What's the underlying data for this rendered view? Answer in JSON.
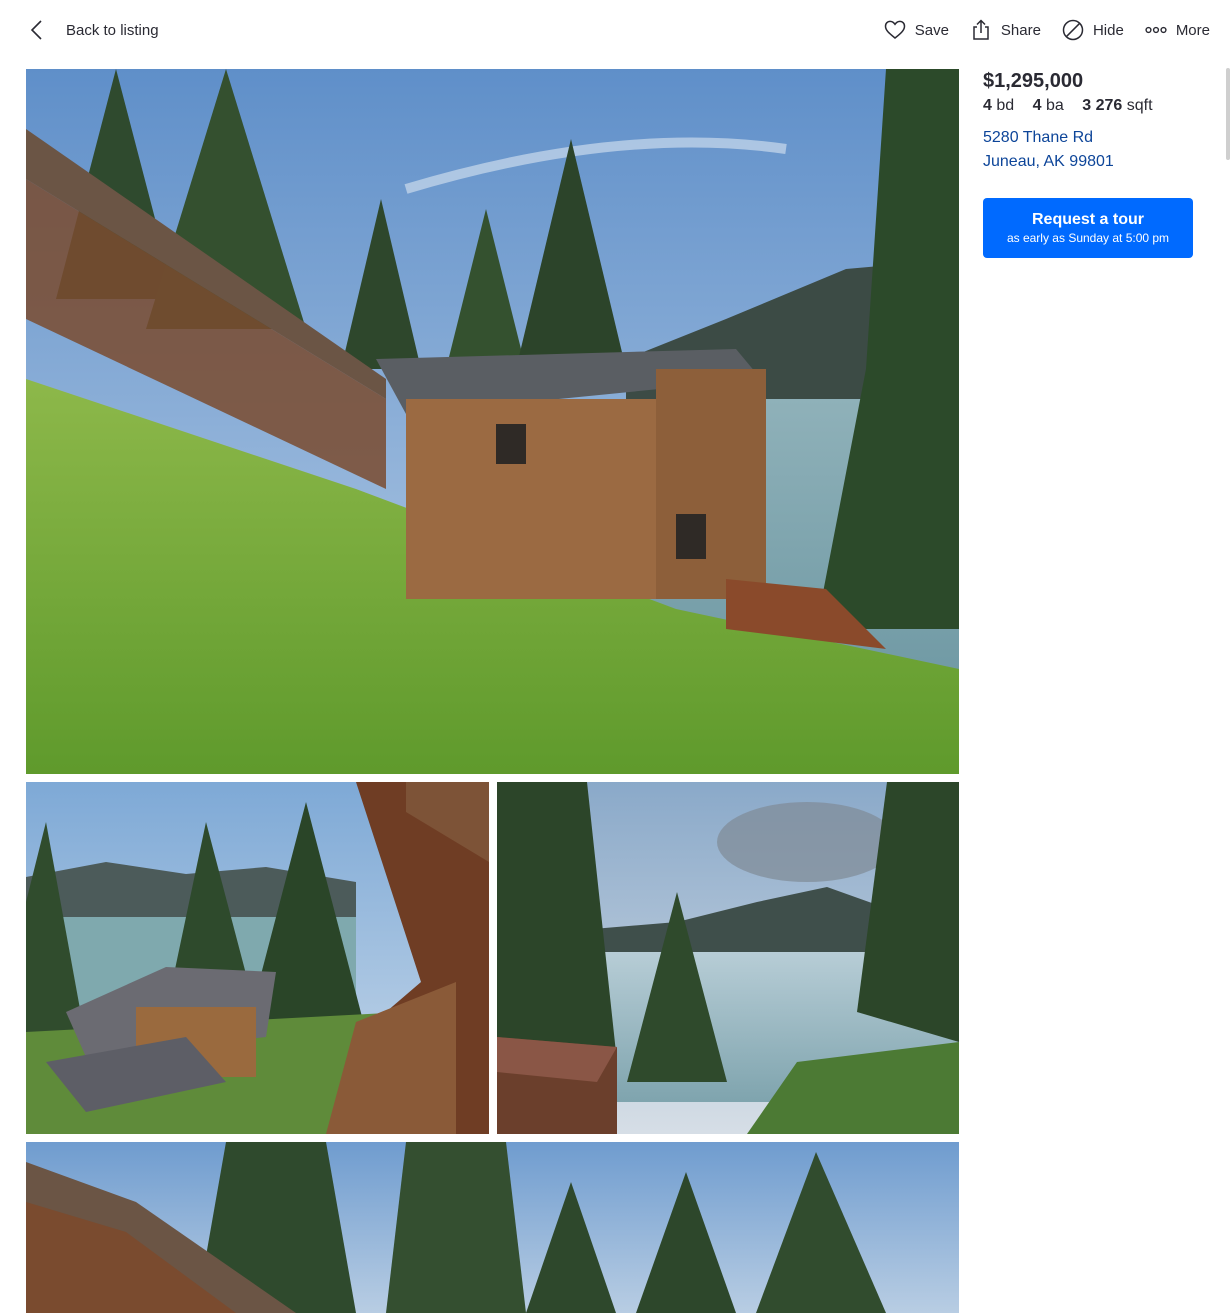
{
  "header": {
    "back_label": "Back to listing",
    "actions": [
      {
        "label": "Save",
        "icon": "heart-icon"
      },
      {
        "label": "Share",
        "icon": "share-icon"
      },
      {
        "label": "Hide",
        "icon": "hide-icon"
      },
      {
        "label": "More",
        "icon": "more-icon"
      }
    ]
  },
  "listing": {
    "price": "$1,295,000",
    "beds_num": "4",
    "beds_unit": "bd",
    "baths_num": "4",
    "baths_unit": "ba",
    "sqft_num": "3 276",
    "sqft_unit": "sqft",
    "address_line1": "5280 Thane Rd",
    "address_line2": "Juneau, AK 99801"
  },
  "tour_button": {
    "title": "Request a tour",
    "subtitle": "as early as Sunday at 5:00 pm"
  },
  "photos": [
    {
      "name": "house-hillside-photo"
    },
    {
      "name": "deck-view-photo"
    },
    {
      "name": "channel-view-photo"
    },
    {
      "name": "stairway-trees-photo"
    }
  ],
  "colors": {
    "accent": "#006aff",
    "link": "#0d4599",
    "text": "#2a2a33"
  }
}
